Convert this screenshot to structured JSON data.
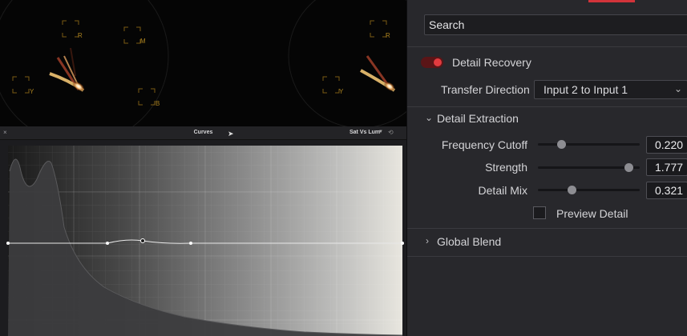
{
  "scopes": {
    "labels_left": [
      "R",
      "M",
      "Y",
      "B"
    ],
    "labels_right": [
      "R",
      "Y"
    ]
  },
  "curves": {
    "close_icon": "×",
    "title": "Curves",
    "mode": "Sat Vs Lum",
    "mode_arrow": "▼",
    "reset_icon": "⟲",
    "cursor_icon": "➤"
  },
  "inspector": {
    "accent_color": "#d2333a",
    "search": {
      "value": "Search"
    },
    "detail_recovery": {
      "label": "Detail Recovery",
      "enabled": true
    },
    "transfer_direction": {
      "label": "Transfer Direction",
      "value": "Input 2 to Input 1",
      "chevron": "⌄"
    },
    "detail_extraction": {
      "label": "Detail Extraction",
      "expanded": true,
      "chevron": "⌄",
      "params": [
        {
          "label": "Frequency Cutoff",
          "value": "0.220",
          "level": 0.23
        },
        {
          "label": "Strength",
          "value": "1.777",
          "level": 0.89
        },
        {
          "label": "Detail Mix",
          "value": "0.321",
          "level": 0.33
        }
      ],
      "preview": {
        "label": "Preview Detail",
        "checked": false
      }
    },
    "global_blend": {
      "label": "Global Blend",
      "expanded": false,
      "chevron": "›"
    }
  }
}
